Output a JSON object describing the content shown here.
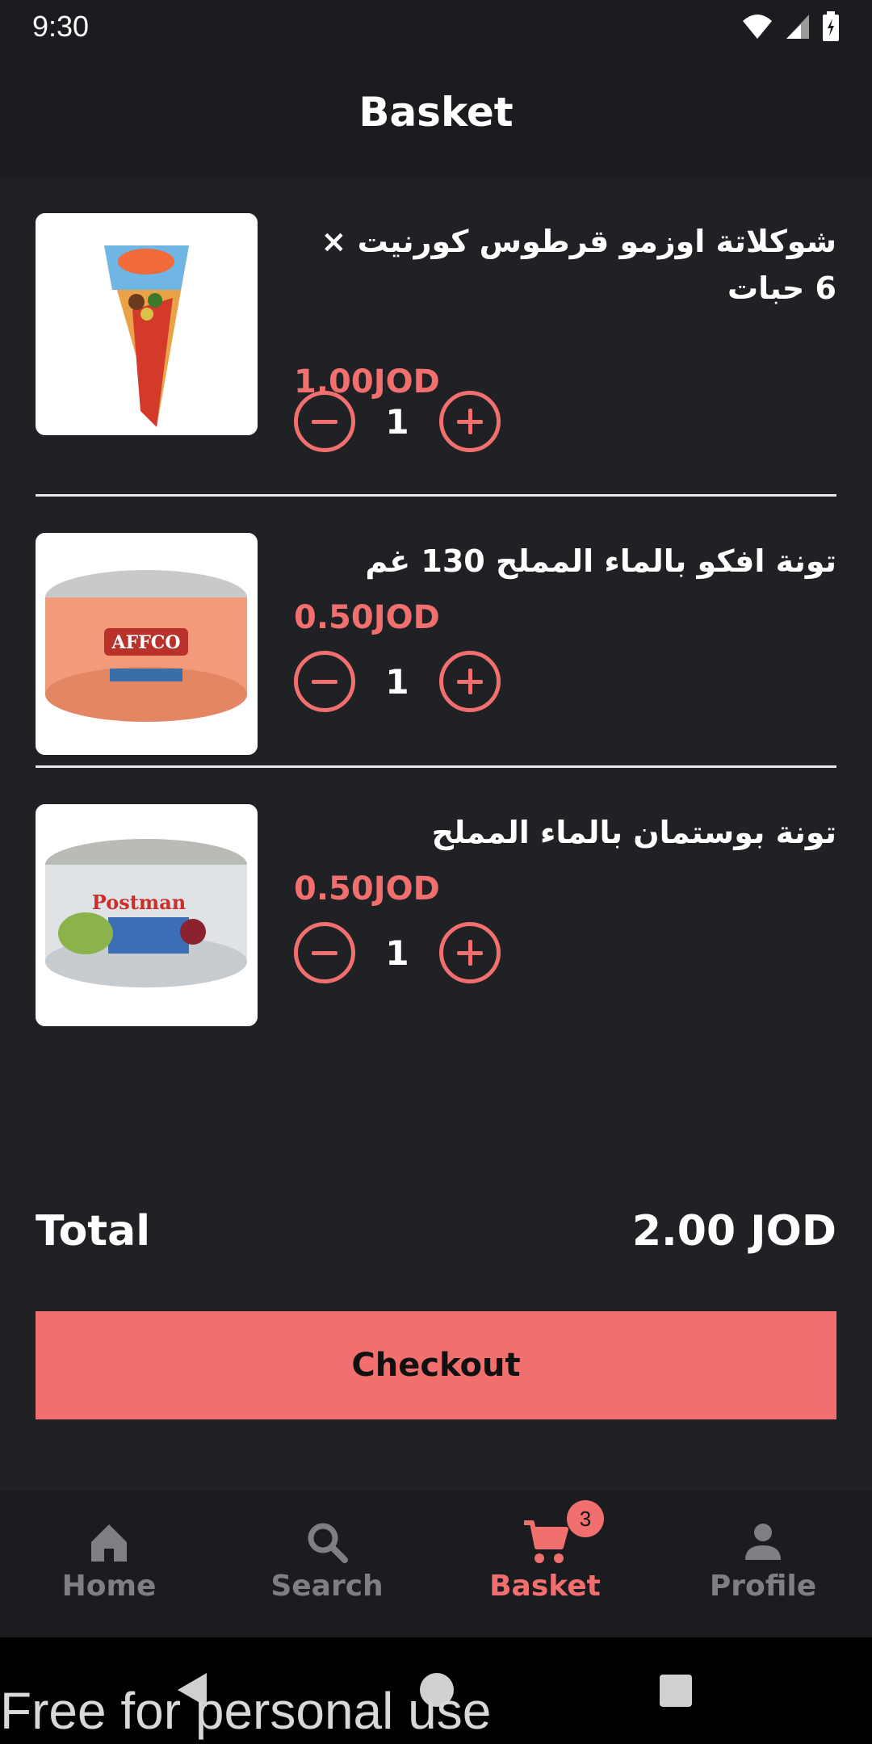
{
  "status_bar": {
    "time": "9:30"
  },
  "app_bar": {
    "title": "Basket"
  },
  "items": [
    {
      "name": "شوكلاتة اوزمو قرطوس كورنيت × 6 حبات",
      "price": "1.00JOD",
      "quantity": "1"
    },
    {
      "name": "تونة افكو بالماء المملح 130 غم",
      "price": "0.50JOD",
      "quantity": "1"
    },
    {
      "name": "تونة بوستمان بالماء المملح",
      "price": "0.50JOD",
      "quantity": "1"
    }
  ],
  "summary": {
    "total_label": "Total",
    "total_value": "2.00 JOD"
  },
  "checkout": {
    "label": "Checkout"
  },
  "nav": {
    "home": "Home",
    "search": "Search",
    "basket": "Basket",
    "basket_badge": "3",
    "profile": "Profile"
  },
  "watermark": "Free for personal use",
  "colors": {
    "accent": "#f26f6f",
    "background": "#202124",
    "bar": "#1b1c1f",
    "inactive": "#7d7f84"
  },
  "icons": [
    "wifi-icon",
    "signal-icon",
    "battery-icon",
    "minus-icon",
    "plus-icon",
    "home-icon",
    "search-icon",
    "cart-icon",
    "person-icon",
    "back-icon",
    "home-circle-icon",
    "recents-icon"
  ]
}
